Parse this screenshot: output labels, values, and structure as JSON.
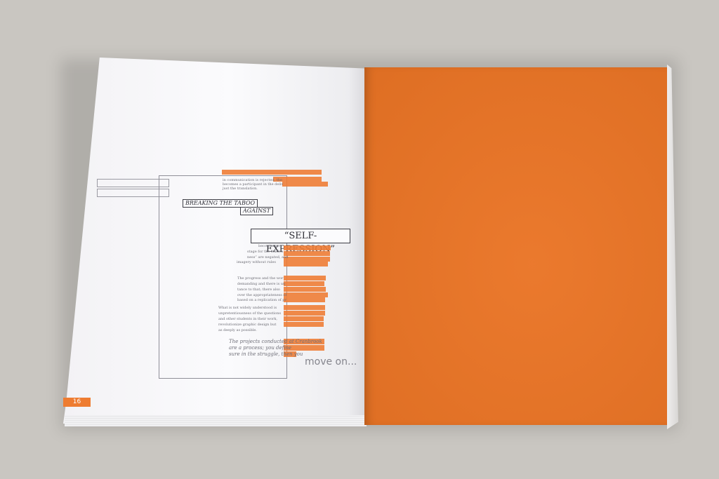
{
  "book": {
    "headings": {
      "breaking_line": "BREAKING THE TABOO",
      "against_line": "AGAINST",
      "main_phrase": "“SELF-EXPRESSION”"
    },
    "text_fragments": [
      "in communication is rejected, the",
      "becomes a participant in the deliv",
      "just the translation.",
      "becomes an",
      "stage for the studen",
      "ness” are negated, and",
      "imagery without rules",
      "The progress and the wor",
      "demanding and there is un",
      "tance to that; there also",
      "over the appropriateness of",
      "based on a replication of pr",
      "What is not widely understood is",
      "unpretentiousness of the questions",
      "and other students in their work,",
      "revolutionize graphic design but",
      "as deeply as possible."
    ],
    "quote_lines": [
      "The projects conducted at Cranbrook",
      "are a process; you define",
      "sure in the struggle, then you"
    ],
    "move_on": "move on...",
    "page_number": "16",
    "colors": {
      "accent": "#ea7425",
      "paper": "#f8f8fa",
      "background": "#c9c6c1"
    }
  }
}
